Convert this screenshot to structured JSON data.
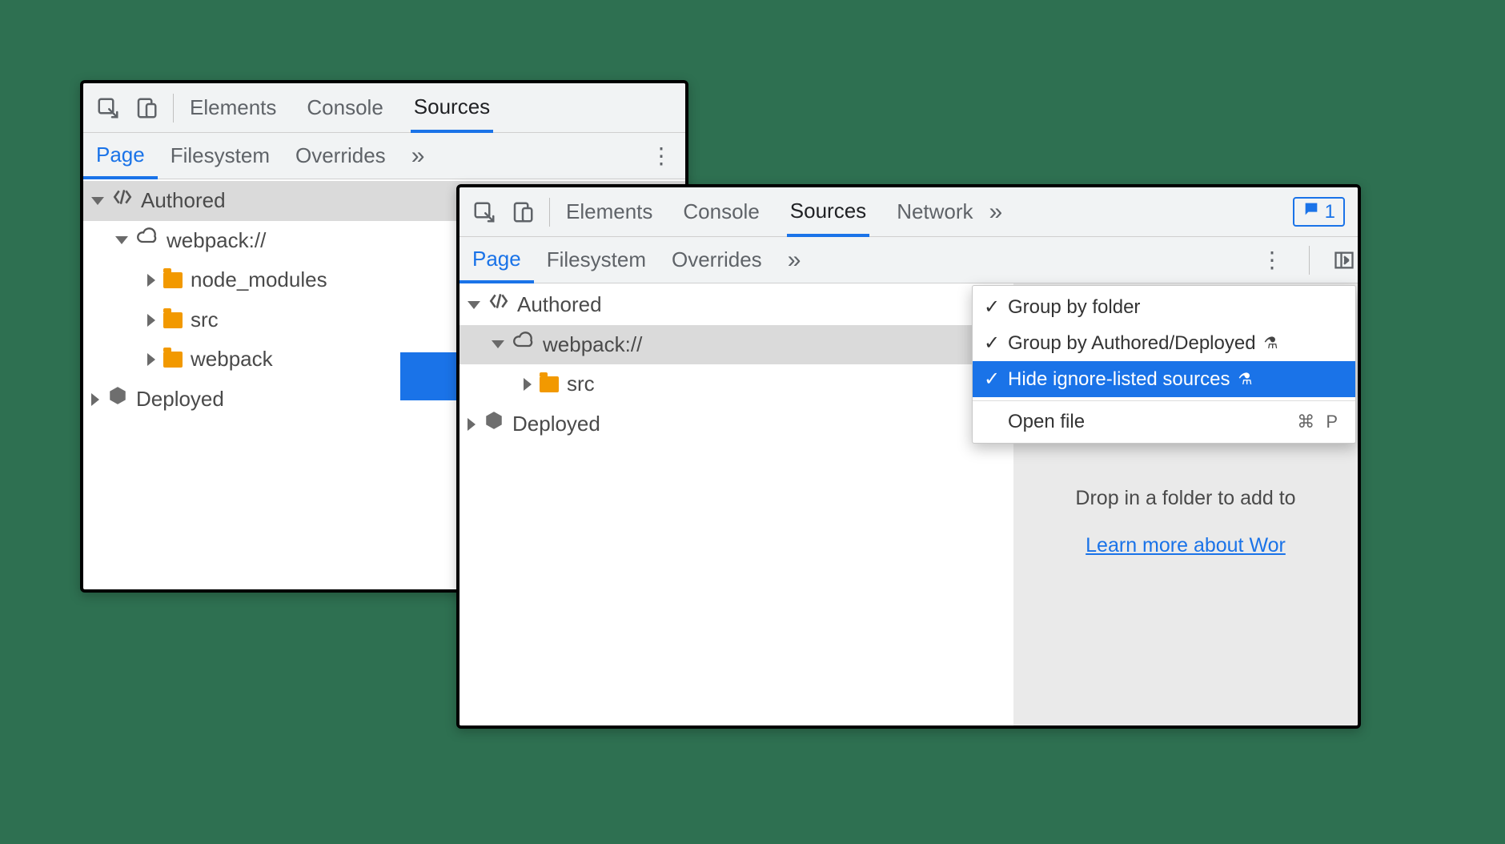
{
  "left": {
    "main_tabs": [
      "Elements",
      "Console",
      "Sources"
    ],
    "active_main_tab": "Sources",
    "sub_tabs": [
      "Page",
      "Filesystem",
      "Overrides"
    ],
    "active_sub_tab": "Page",
    "tree": {
      "authored_label": "Authored",
      "webpack_label": "webpack://",
      "children": [
        "node_modules",
        "src",
        "webpack"
      ],
      "deployed_label": "Deployed"
    }
  },
  "right": {
    "main_tabs": [
      "Elements",
      "Console",
      "Sources",
      "Network"
    ],
    "active_main_tab": "Sources",
    "message_count": "1",
    "sub_tabs": [
      "Page",
      "Filesystem",
      "Overrides"
    ],
    "active_sub_tab": "Page",
    "tree": {
      "authored_label": "Authored",
      "webpack_label": "webpack://",
      "children": [
        "src"
      ],
      "deployed_label": "Deployed"
    },
    "menu": {
      "group_by_folder": "Group by folder",
      "group_by_authored": "Group by Authored/Deployed",
      "hide_ignore_listed": "Hide ignore-listed sources",
      "open_file": "Open file",
      "open_file_shortcut": "⌘ P"
    },
    "hint": {
      "line1": "Drop in a folder to add to",
      "link": "Learn more about Wor"
    }
  }
}
